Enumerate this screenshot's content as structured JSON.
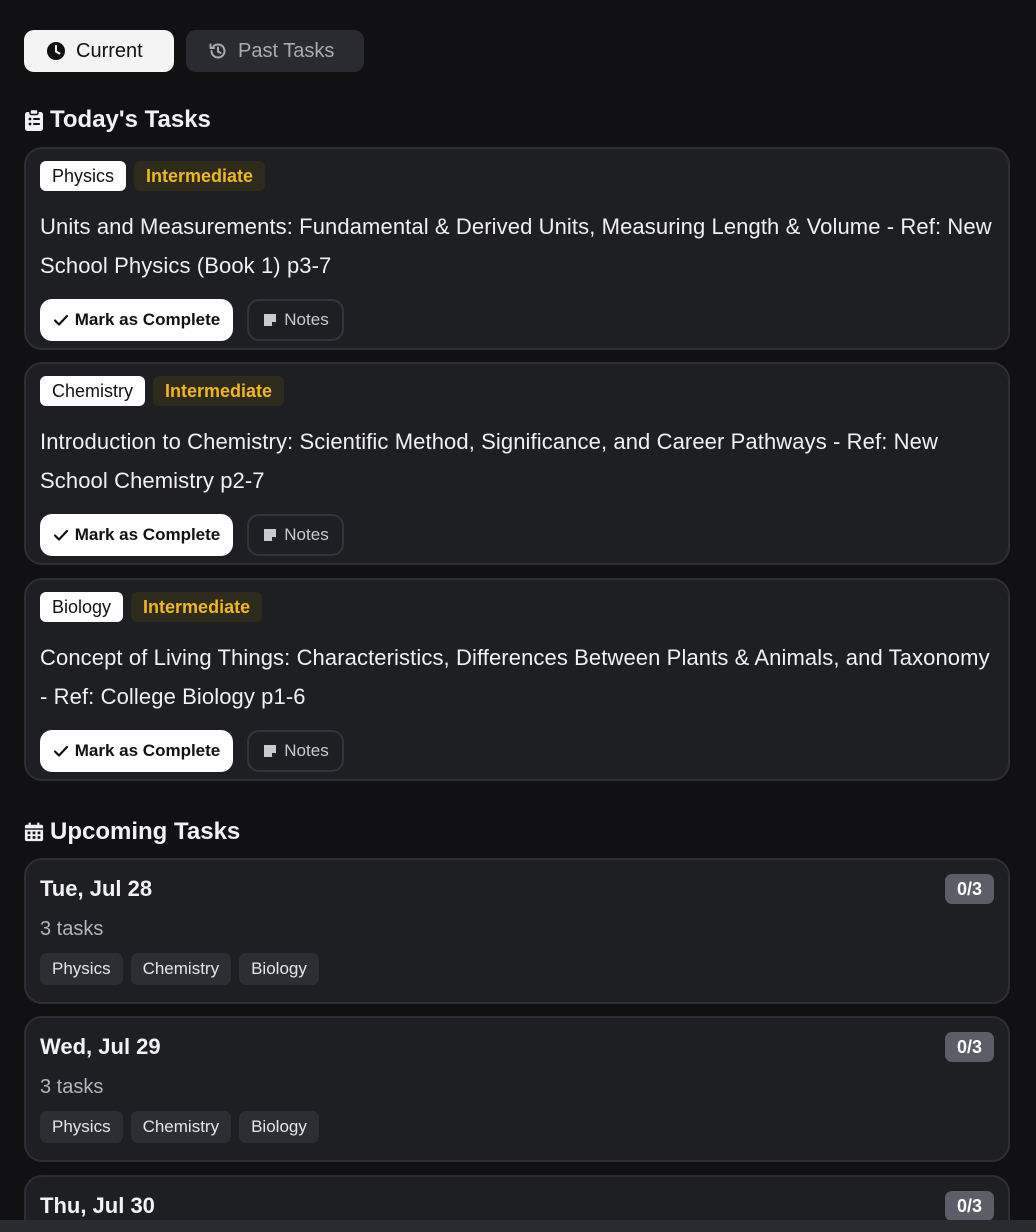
{
  "tabs": [
    {
      "label": "Current",
      "icon": "clock-icon",
      "active": true
    },
    {
      "label": "Past Tasks",
      "icon": "history-icon",
      "active": false
    }
  ],
  "todays": {
    "title": "Today's Tasks",
    "icon": "clipboard-list-icon",
    "tasks": [
      {
        "subject": "Physics",
        "level": "Intermediate",
        "text": "Units and Measurements: Fundamental & Derived Units, Measuring Length & Volume - Ref: New School Physics (Book 1) p3-7",
        "complete_label": "Mark as Complete",
        "notes_label": "Notes"
      },
      {
        "subject": "Chemistry",
        "level": "Intermediate",
        "text": "Introduction to Chemistry: Scientific Method, Significance, and Career Pathways - Ref: New School Chemistry p2-7",
        "complete_label": "Mark as Complete",
        "notes_label": "Notes"
      },
      {
        "subject": "Biology",
        "level": "Intermediate",
        "text": "Concept of Living Things: Characteristics, Differences Between Plants & Animals, and Taxonomy - Ref: College Biology p1-6",
        "complete_label": "Mark as Complete",
        "notes_label": "Notes"
      }
    ]
  },
  "upcoming": {
    "title": "Upcoming Tasks",
    "icon": "calendar-icon",
    "days": [
      {
        "date": "Tue, Jul 28",
        "count": "0/3",
        "sub": "3 tasks",
        "subjects": [
          "Physics",
          "Chemistry",
          "Biology"
        ]
      },
      {
        "date": "Wed, Jul 29",
        "count": "0/3",
        "sub": "3 tasks",
        "subjects": [
          "Physics",
          "Chemistry",
          "Biology"
        ]
      },
      {
        "date": "Thu, Jul 30",
        "count": "0/3",
        "sub": "",
        "subjects": []
      }
    ]
  },
  "colors": {
    "background": "#111113",
    "card": "#1e1f23",
    "level_text": "#f0b622",
    "count_badge": "#5b5e66"
  }
}
